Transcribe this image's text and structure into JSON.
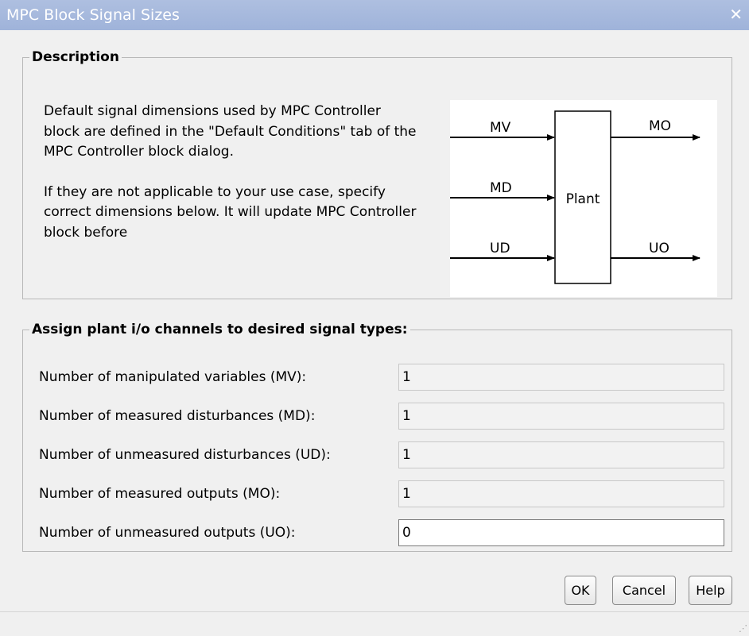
{
  "window": {
    "title": "MPC Block Signal Sizes",
    "close_glyph": "✕"
  },
  "description": {
    "legend": "Description",
    "paragraph1": "Default signal dimensions used by MPC Controller block are defined in the \"Default Conditions\" tab of the MPC Controller block dialog.",
    "paragraph2": "If they are not applicable to your use case, specify correct dimensions below. It will update MPC Controller block before",
    "diagram": {
      "block_label": "Plant",
      "inputs": [
        "MV",
        "MD",
        "UD"
      ],
      "outputs": [
        "MO",
        "UO"
      ]
    }
  },
  "assign": {
    "legend": "Assign plant i/o channels to desired signal types:",
    "rows": [
      {
        "label": "Number of manipulated variables (MV):",
        "value": "1"
      },
      {
        "label": "Number of measured disturbances (MD):",
        "value": "1"
      },
      {
        "label": "Number of unmeasured disturbances (UD):",
        "value": "1"
      },
      {
        "label": "Number of measured outputs (MO):",
        "value": "1"
      },
      {
        "label": "Number of unmeasured outputs (UO):",
        "value": "0"
      }
    ]
  },
  "buttons": {
    "ok": "OK",
    "cancel": "Cancel",
    "help": "Help"
  }
}
